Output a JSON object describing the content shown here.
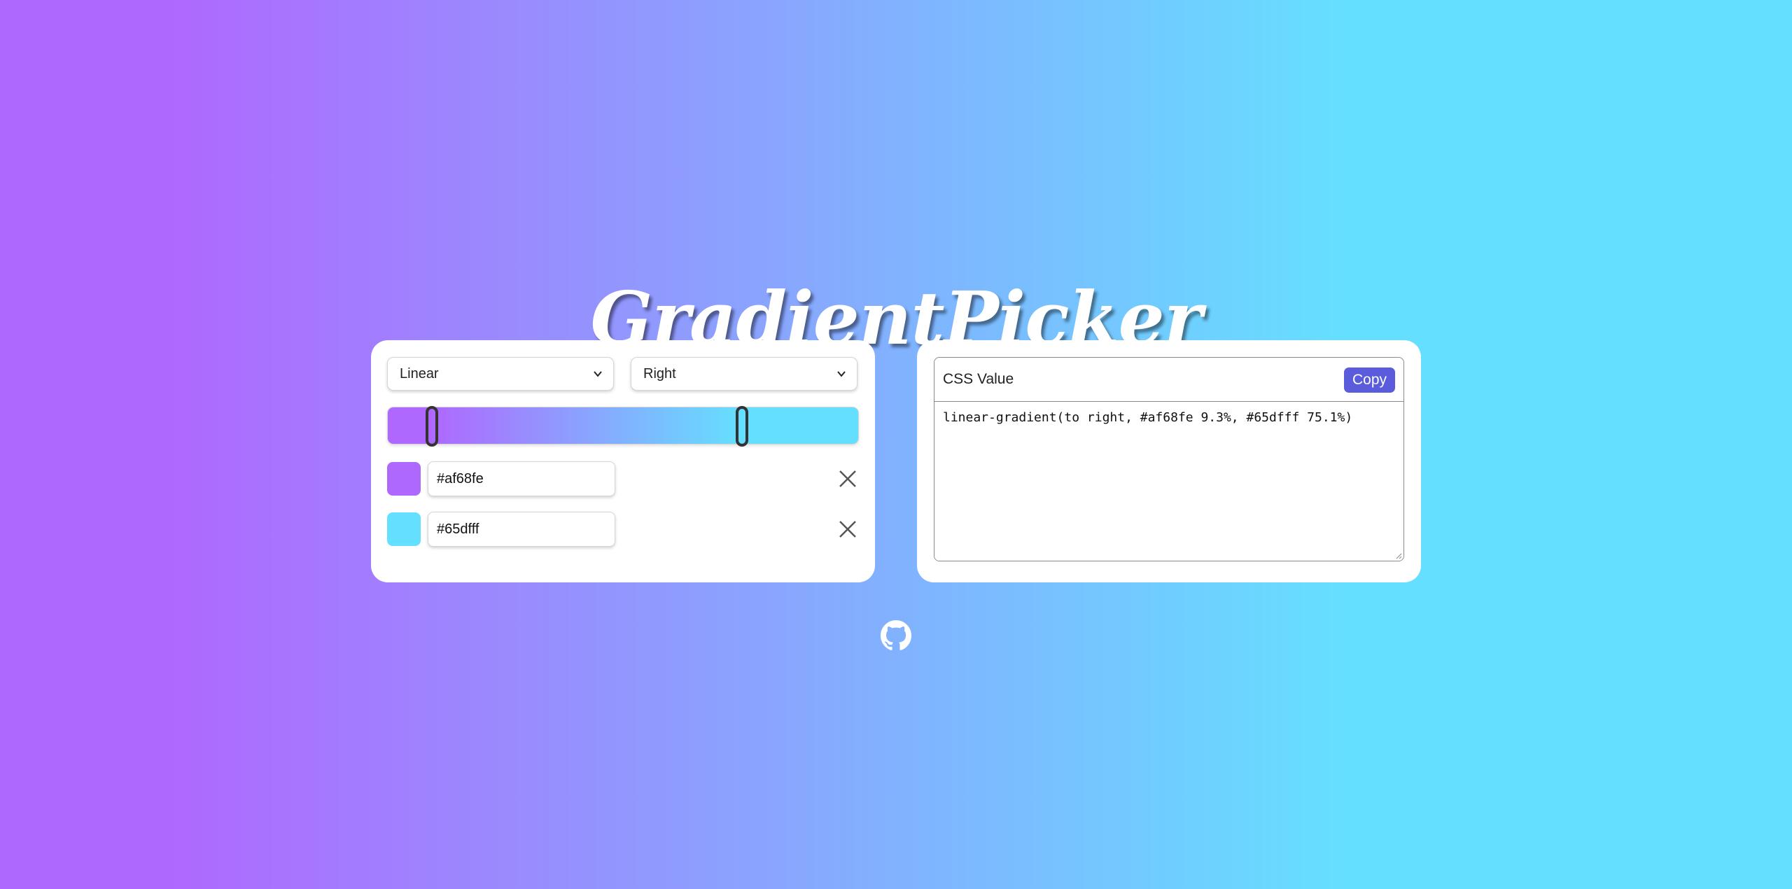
{
  "app": {
    "title": "GradientPicker"
  },
  "gradient": {
    "type_options": [
      "Linear"
    ],
    "type_selected": "Linear",
    "direction_options": [
      "Right"
    ],
    "direction_selected": "Right",
    "stops": [
      {
        "color": "#af68fe",
        "hex": "#af68fe",
        "position_percent": 9.3
      },
      {
        "color": "#65dfff",
        "hex": "#65dfff",
        "position_percent": 75.1
      }
    ]
  },
  "output": {
    "label": "CSS Value",
    "copy_label": "Copy",
    "value": "linear-gradient(to right, #af68fe 9.3%, #65dfff 75.1%)"
  },
  "icons": {
    "remove": "close-icon",
    "github": "github-icon",
    "chevron": "chevron-down-icon"
  },
  "colors": {
    "copy_button": "#5b5cdc",
    "title_text": "#ffffff",
    "panel_bg": "#ffffff"
  }
}
